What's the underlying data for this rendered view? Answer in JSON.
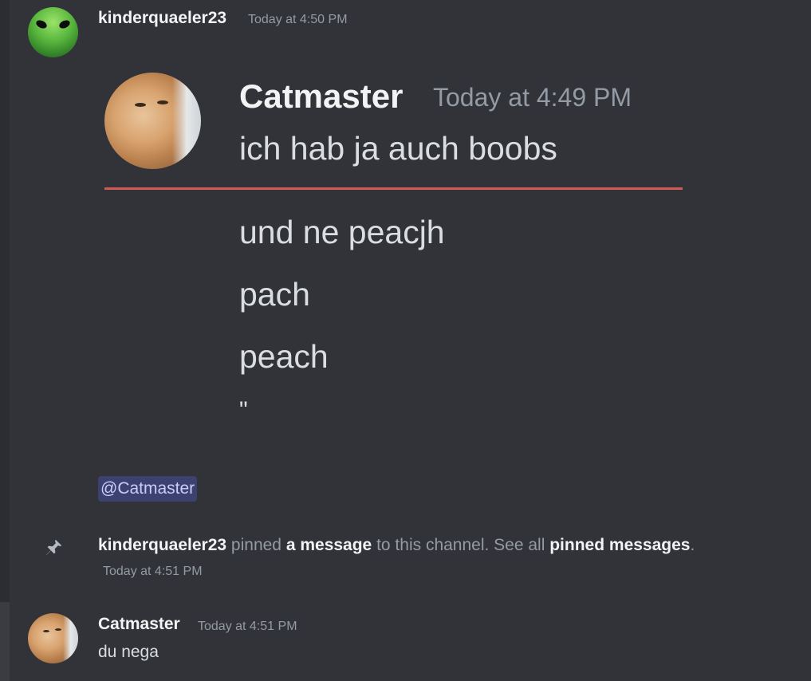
{
  "messages": {
    "first": {
      "author": "kinderquaeler23",
      "timestamp": "Today at 4:50 PM",
      "avatar": "alien-avatar",
      "mention": "@Catmaster",
      "embedded_image": {
        "author": "Catmaster",
        "timestamp": "Today at 4:49 PM",
        "lines": [
          "ich hab ja auch boobs",
          "und ne peacjh",
          "pach",
          "peach",
          "\""
        ]
      }
    },
    "pin_notice": {
      "actor": "kinderquaeler23",
      "text_pinned": " pinned ",
      "link_message": "a message",
      "text_channel": " to this channel. See all ",
      "link_pinned": "pinned messages",
      "text_end": ".",
      "timestamp": "Today at 4:51 PM",
      "icon": "pin-icon"
    },
    "last": {
      "author": "Catmaster",
      "timestamp": "Today at 4:51 PM",
      "avatar": "cat-avatar",
      "text": "du nega"
    }
  },
  "colors": {
    "background": "#313338",
    "mention_bg": "#3c4270",
    "separator_red": "#d25a55"
  }
}
